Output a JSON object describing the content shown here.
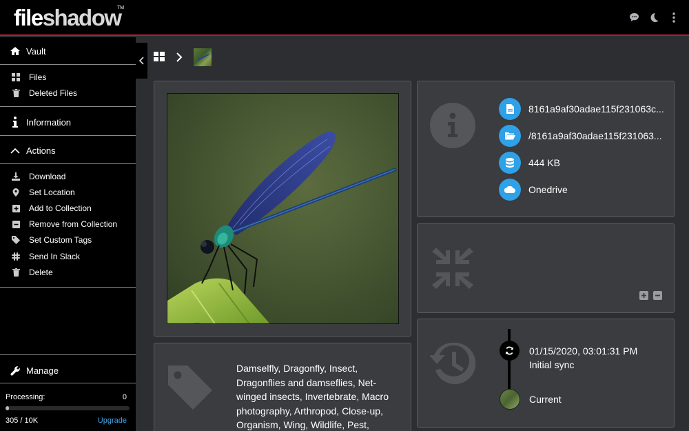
{
  "app": {
    "logo_part1": "file",
    "logo_part2": "shadow",
    "logo_tm": "TM"
  },
  "topbar": {
    "icons": [
      "chat-icon",
      "moon-icon",
      "more-vertical-icon"
    ]
  },
  "sidebar": {
    "vault_label": "Vault",
    "files_label": "Files",
    "deleted_files_label": "Deleted Files",
    "information_label": "Information",
    "actions_label": "Actions",
    "actions": [
      {
        "label": "Download",
        "icon": "download-icon"
      },
      {
        "label": "Set Location",
        "icon": "map-pin-icon"
      },
      {
        "label": "Add to Collection",
        "icon": "plus-square-icon"
      },
      {
        "label": "Remove from Collection",
        "icon": "minus-square-icon"
      },
      {
        "label": "Set Custom Tags",
        "icon": "tag-icon"
      },
      {
        "label": "Send In Slack",
        "icon": "slack-icon"
      },
      {
        "label": "Delete",
        "icon": "trash-icon"
      }
    ],
    "manage_label": "Manage",
    "processing_label": "Processing:",
    "processing_count": "0",
    "usage_text": "305 / 10K",
    "usage_fraction": 0.0305,
    "upgrade_label": "Upgrade"
  },
  "info": {
    "file_name": "8161a9af30adae115f231063c...",
    "path": "/8161a9af30adae115f231063...",
    "size": "444 KB",
    "source": "Onedrive"
  },
  "tags": {
    "text": "Damselfly, Dragonfly, Insect, Dragonflies and damseflies, Net-winged insects, Invertebrate, Macro photography, Arthropod, Close-up, Organism, Wing, Wildlife, Pest,"
  },
  "history": {
    "entries": [
      {
        "timestamp": "01/15/2020, 03:01:31 PM",
        "label": "Initial sync"
      }
    ],
    "current_label": "Current"
  },
  "colors": {
    "accent_blue": "#2ea1e8",
    "topbar_border": "#b3202a",
    "upgrade_link": "#3fa9f5"
  }
}
